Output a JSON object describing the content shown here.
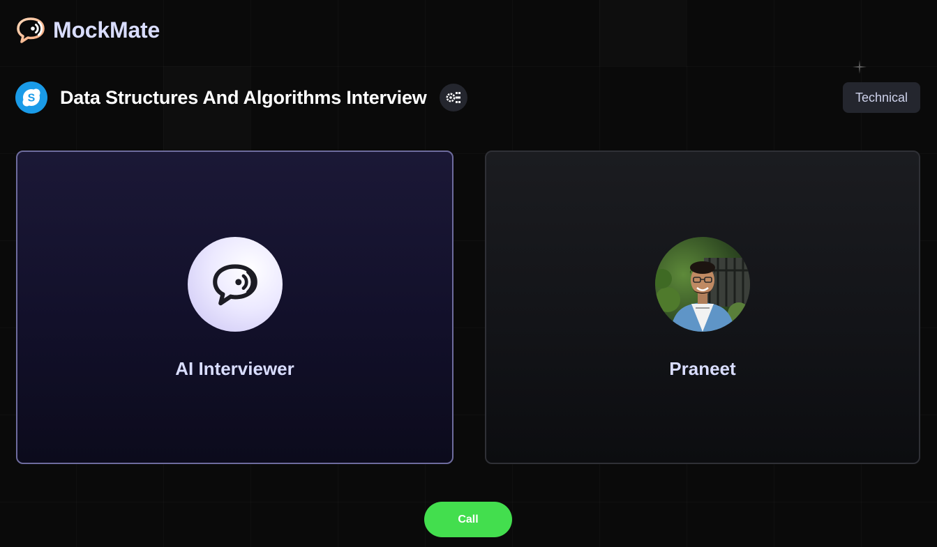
{
  "brand": {
    "name": "MockMate",
    "icon": "chat-voice-icon"
  },
  "interview": {
    "title": "Data Structures And Algorithms Interview",
    "tech_icon": "skype-icon",
    "stack_icon": "tech-stack-icon",
    "type_badge": "Technical"
  },
  "cards": {
    "interviewer": {
      "name": "AI Interviewer",
      "avatar_icon": "chat-voice-icon"
    },
    "user": {
      "name": "Praneet",
      "avatar": "user-photo"
    }
  },
  "actions": {
    "call_label": "Call"
  },
  "colors": {
    "background": "#0a0a0a",
    "brand_text": "#d9ddff",
    "call_button": "#43de4e",
    "tech_logo": "#1a9be8",
    "badge_bg": "#24262e",
    "interviewer_card_border": "#6e6c9e",
    "user_card_border": "#2f3036"
  }
}
